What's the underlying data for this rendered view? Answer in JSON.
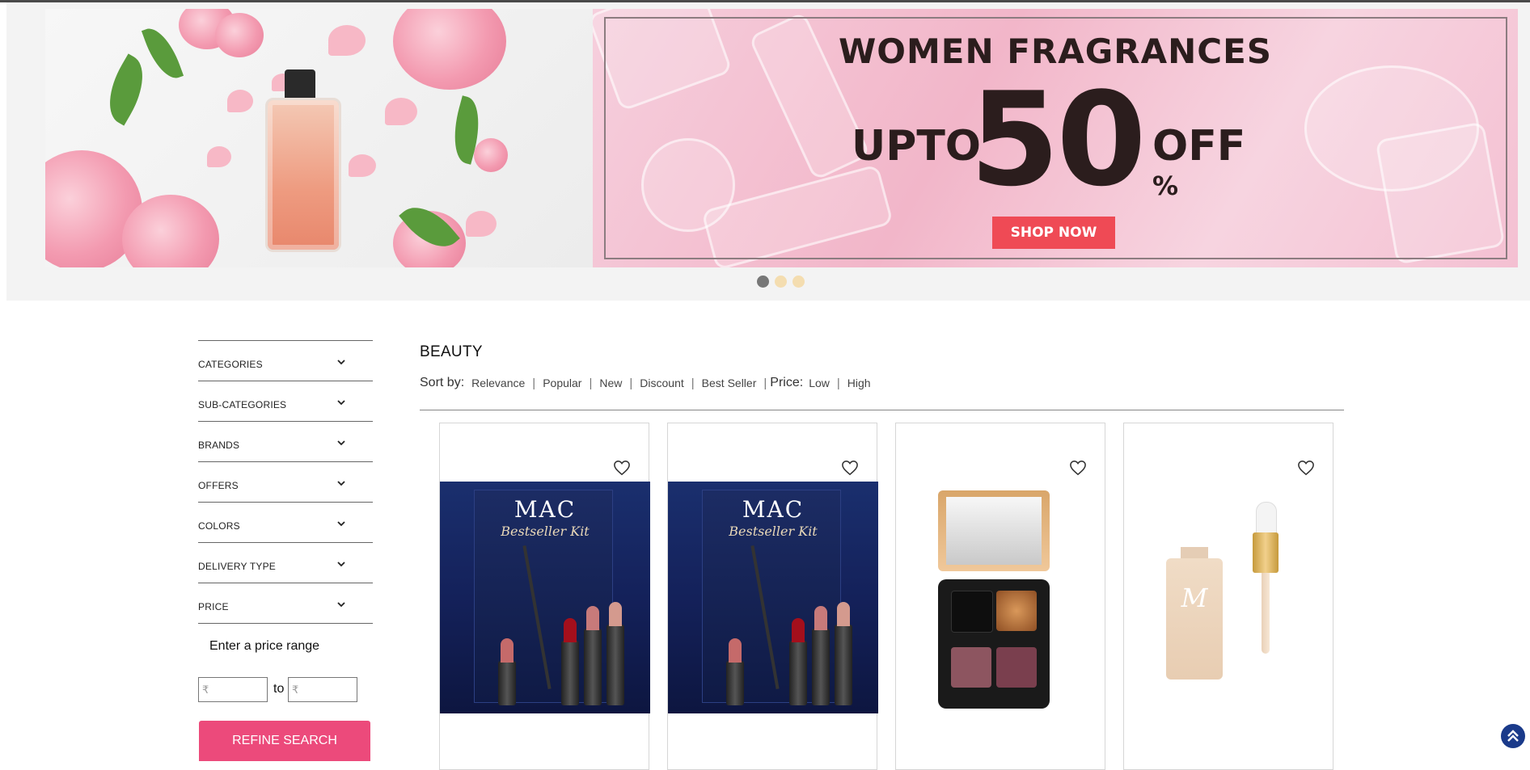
{
  "banner": {
    "title": "WOMEN FRAGRANCES",
    "upto": "UPTO",
    "number": "50",
    "percent": "%",
    "off": "OFF",
    "cta": "SHOP NOW",
    "slides_total": 3,
    "active_slide": 1,
    "colors": {
      "cta": "#ef4a55",
      "text": "#2b1d1d"
    }
  },
  "sidebar": {
    "filters": [
      {
        "label": "CATEGORIES"
      },
      {
        "label": "SUB-CATEGORIES"
      },
      {
        "label": "BRANDS"
      },
      {
        "label": "OFFERS"
      },
      {
        "label": "COLORS"
      },
      {
        "label": "DELIVERY TYPE"
      },
      {
        "label": "PRICE"
      }
    ],
    "price_range_label": "Enter a price range",
    "min_placeholder": "₹",
    "max_placeholder": "₹",
    "to_label": "to",
    "refine_button": "REFINE SEARCH",
    "refine_color": "#ec4a7b"
  },
  "listing": {
    "heading": "BEAUTY",
    "sort_label": "Sort by:",
    "sort_options": [
      "Relevance",
      "Popular",
      "New",
      "Discount",
      "Best Seller"
    ],
    "price_label": "Price:",
    "price_options": [
      "Low",
      "High"
    ]
  },
  "products": [
    {
      "image": "mac-bestseller-kit",
      "logo": "MAC",
      "subtitle": "Bestseller Kit",
      "icon": "heart-icon"
    },
    {
      "image": "mac-bestseller-kit",
      "logo": "MAC",
      "subtitle": "Bestseller Kit",
      "icon": "heart-icon"
    },
    {
      "image": "eyeshadow-palette",
      "icon": "heart-icon"
    },
    {
      "image": "liquid-highlighter",
      "logo": "M",
      "icon": "heart-icon"
    }
  ],
  "scroll_top_icon": "double-chevron-up-icon"
}
